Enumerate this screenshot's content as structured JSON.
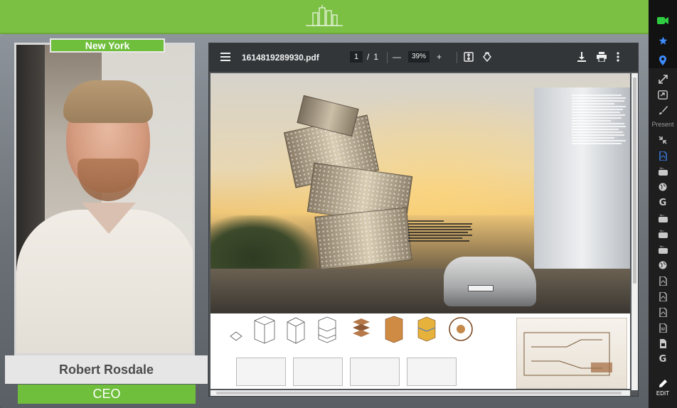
{
  "app": {
    "background": "conference-background",
    "accent_color": "#7bc043",
    "logo_icon": "city-skyline-logo"
  },
  "presenter": {
    "location": "New York",
    "name": "Robert Rosdale",
    "role": "CEO"
  },
  "pdf_viewer": {
    "file_name": "1614819289930.pdf",
    "page_current": "1",
    "page_separator": "/",
    "page_total": "1",
    "zoom_level": "39%",
    "zoom_out_symbol": "—",
    "zoom_in_symbol": "+",
    "icons": {
      "menu": "menu-icon",
      "fit": "fit-to-page-icon",
      "rotate": "rotate-icon",
      "download": "download-icon",
      "print": "print-icon",
      "more": "more-vert-icon"
    }
  },
  "right_toolbar": {
    "top_icons": [
      "more-icon",
      "camera-icon",
      "star-icon",
      "location-pin-icon"
    ],
    "tool_icons": [
      "expand-icon",
      "share-screen-icon",
      "brush-icon"
    ],
    "present_label": "Present",
    "present_icons": [
      "compress-icon",
      "pdf-icon",
      "youtube-icon",
      "globe-icon",
      "google-icon",
      "youtube-icon",
      "youtube-icon",
      "youtube-icon",
      "globe-icon",
      "pdf-icon",
      "pdf-icon",
      "pdf-icon",
      "word-icon",
      "slides-icon",
      "google-icon"
    ],
    "edit_label": "EDIT"
  }
}
